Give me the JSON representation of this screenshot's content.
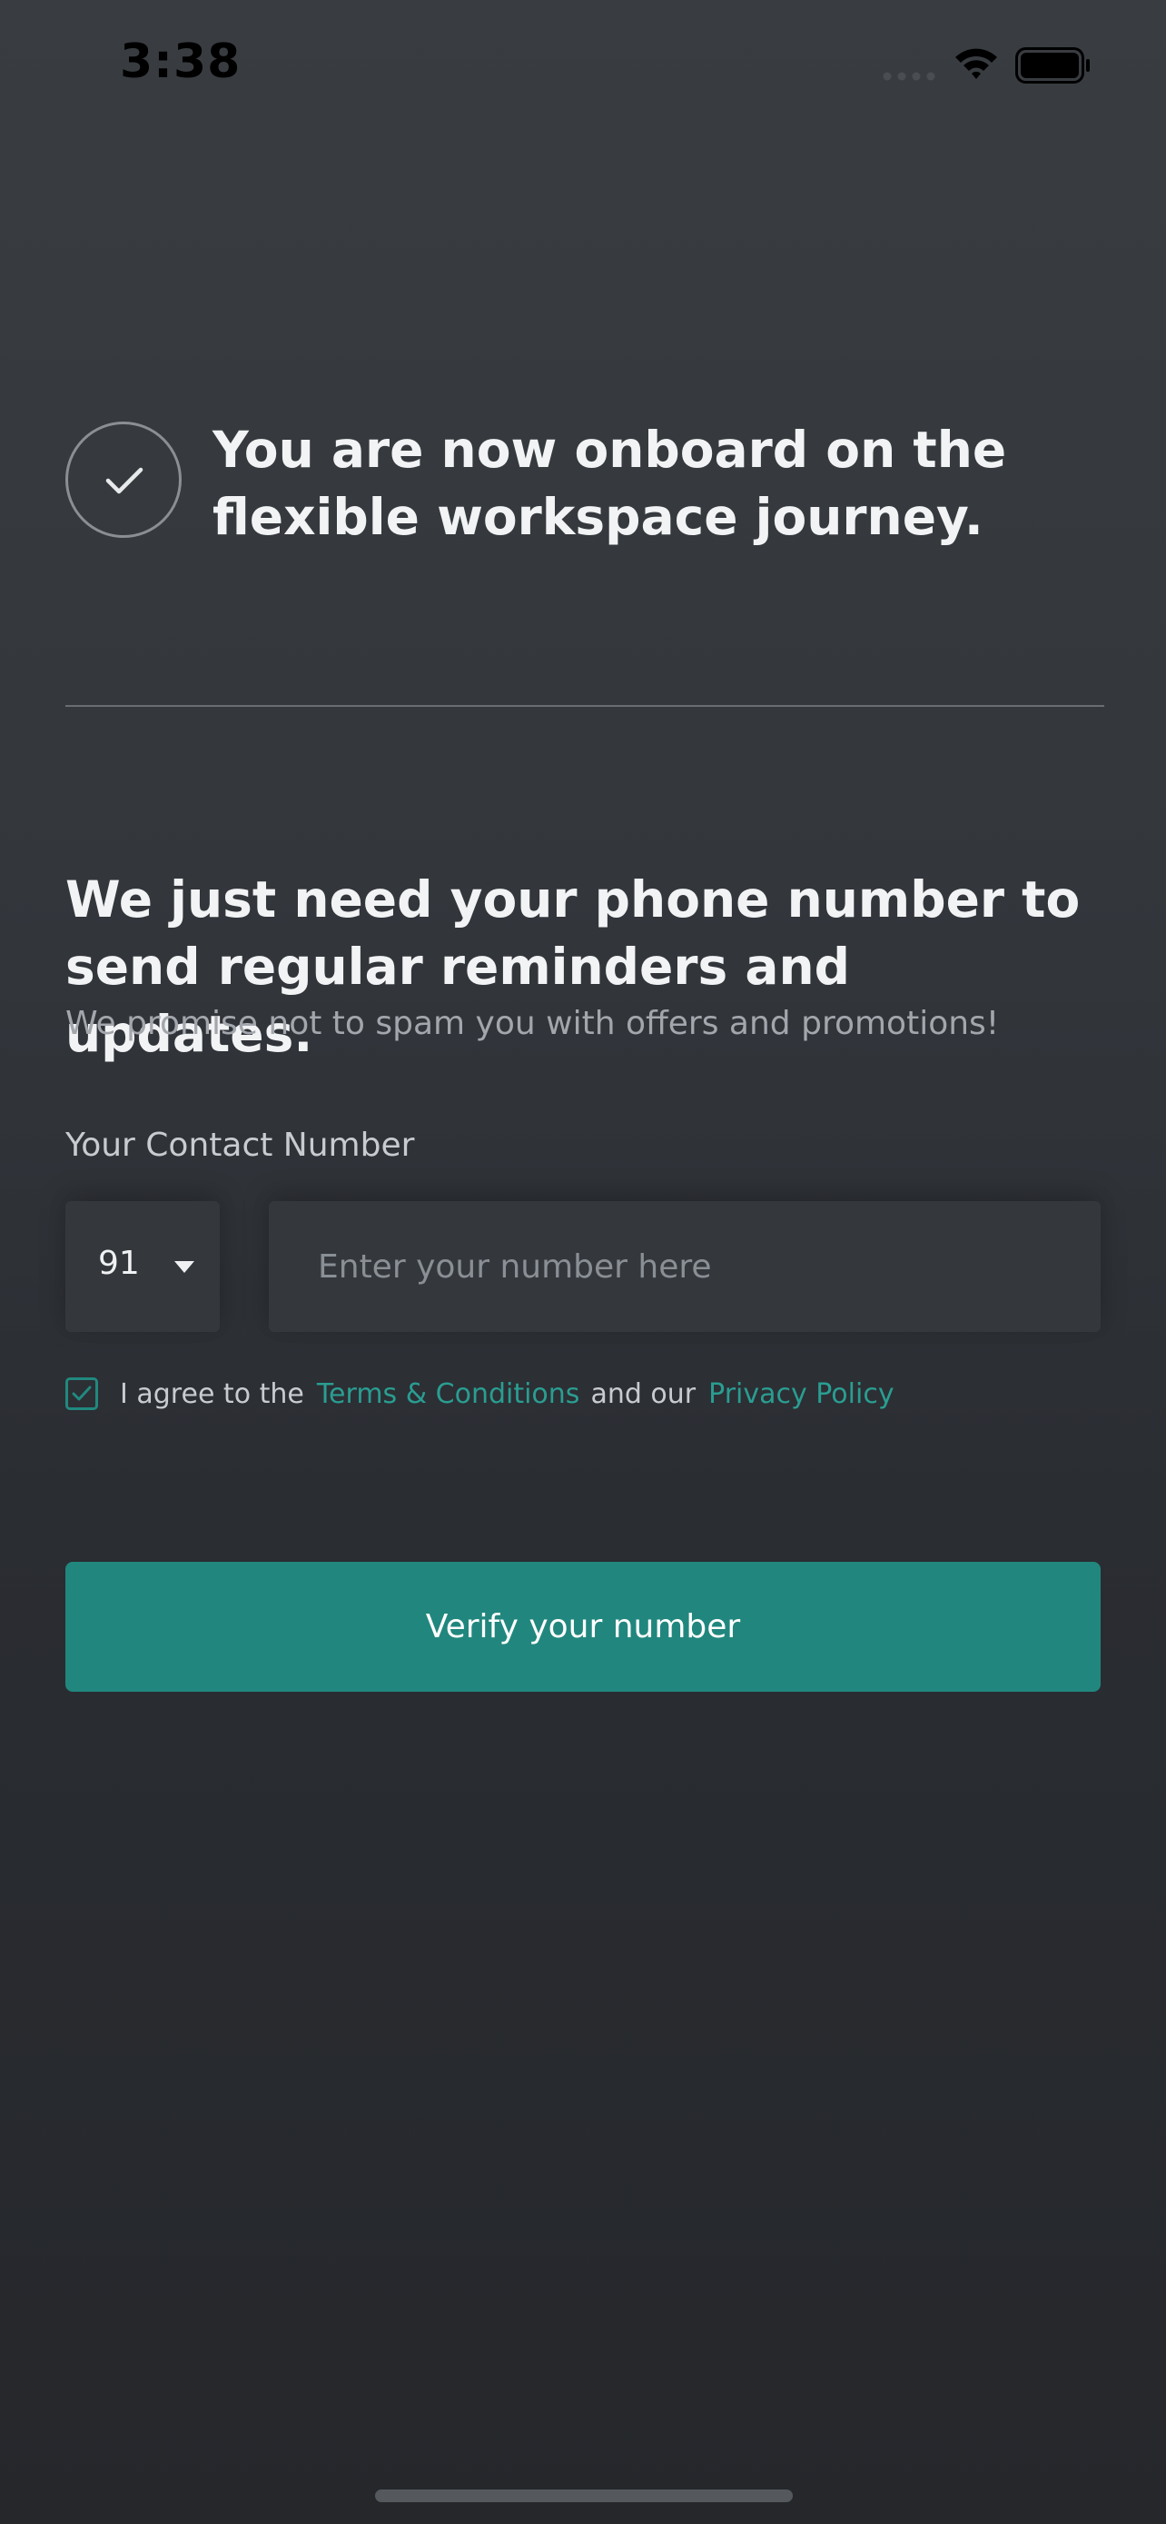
{
  "status_bar": {
    "time": "3:38",
    "icons": [
      "signal-icon",
      "wifi-icon",
      "battery-icon"
    ]
  },
  "onboard": {
    "icon": "check-icon",
    "title": "You are now onboard on the flexible workspace journey."
  },
  "phone_section": {
    "heading": "We just need your phone number to send regular reminders and updates.",
    "subheading": "We promise not to spam you with offers and promotions!",
    "contact_label": "Your Contact Number",
    "country_code": "91",
    "phone_value": "",
    "phone_placeholder": "Enter your number here"
  },
  "agreement": {
    "checked": true,
    "prefix": "I agree to the",
    "terms_link": "Terms & Conditions",
    "middle": "and our",
    "privacy_link": "Privacy Policy"
  },
  "verify_button": {
    "label": "Verify your number"
  },
  "colors": {
    "accent": "#21877e",
    "link": "#2a9d91",
    "background_top": "#393d41",
    "background_bottom": "#25272b"
  }
}
